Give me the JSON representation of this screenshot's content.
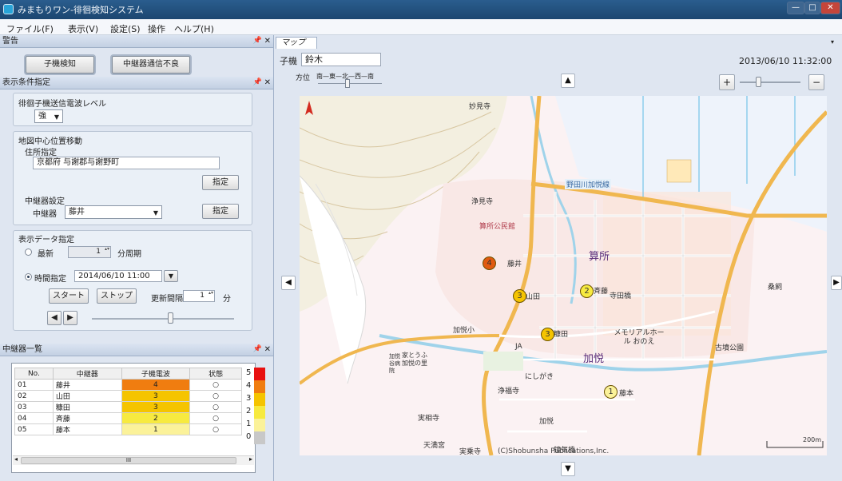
{
  "app": {
    "title": "みまもりワン-徘徊検知システム"
  },
  "window": {
    "min": "—",
    "max": "□",
    "close": "✕"
  },
  "menu": [
    "ファイル(F)",
    "表示(V)",
    "設定(S)",
    "操作",
    "ヘルプ(H)"
  ],
  "alert_panel": {
    "title": "警告",
    "buttons": [
      "子機検知",
      "中継器通信不良"
    ]
  },
  "display_panel": {
    "title": "表示条件指定",
    "signal_level": {
      "label": "徘徊子機送信電波レベル",
      "value": "強"
    },
    "map_center": {
      "label": "地図中心位置移動",
      "address_label": "住所指定",
      "address_value": "京都府 与謝郡与謝野町",
      "address_button": "指定",
      "relay_setting_label": "中継器設定",
      "relay_label": "中継器",
      "relay_value": "藤井",
      "relay_button": "指定"
    },
    "data_spec": {
      "label": "表示データ指定",
      "latest_label": "最新",
      "latest_period": "1",
      "latest_unit": "分周期",
      "time_label": "時間指定",
      "time_value": "2014/06/10 11:00",
      "start_button": "スタート",
      "stop_button": "ストップ",
      "interval_label": "更新間隔",
      "interval_value": "1",
      "interval_unit": "分"
    },
    "playback_slider_value": 0.55
  },
  "relay_panel": {
    "title": "中継器一覧",
    "columns": [
      "No.",
      "中継器",
      "子機電波",
      "状態"
    ],
    "rows": [
      {
        "no": "01",
        "name": "藤井",
        "level": "4",
        "status": "○"
      },
      {
        "no": "02",
        "name": "山田",
        "level": "3",
        "status": "○"
      },
      {
        "no": "03",
        "name": "糠田",
        "level": "3",
        "status": "○"
      },
      {
        "no": "04",
        "name": "斉藤",
        "level": "2",
        "status": "○"
      },
      {
        "no": "05",
        "name": "藤本",
        "level": "1",
        "status": "○"
      }
    ],
    "level_colors": {
      "4": "#f07d10",
      "3": "#f5c400",
      "2": "#f7ea40",
      "1": "#fbf29a",
      "0": "#c8c8c8"
    },
    "legend": [
      "5",
      "4",
      "3",
      "2",
      "1",
      "0"
    ],
    "legend_colors": [
      "#e81010",
      "#f07d10",
      "#f5c400",
      "#f7ea40",
      "#fbf29a",
      "#c8c8c8"
    ],
    "scroll_label": "III"
  },
  "map_panel": {
    "tab": "マップ",
    "child_label": "子機",
    "child_value": "鈴木",
    "direction_label": "方位",
    "direction_scale": "南—東—北—西—南",
    "timestamp": "2013/06/10 11:32:00",
    "zoom_in": "+",
    "zoom_out": "−",
    "zoom_level": 0.3,
    "copyright": "(C)Shobunsha Publications,Inc.",
    "scale_label": "200m",
    "places": {
      "p1": "妙見寺",
      "p2": "浄見寺",
      "p3": "算所公民館",
      "p4": "野田川加悦線",
      "p5": "算所",
      "p6": "加悦",
      "p7": "山田",
      "p8": "藤井",
      "p9": "斉藤",
      "p10": "糠田",
      "p11": "藤本",
      "p12": "寺田橋",
      "p13": "メモリアルホール おのえ",
      "p14": "古墳公園",
      "p15": "JA",
      "p16": "にしがき",
      "p17": "浄福寺",
      "p18": "実相寺",
      "p19": "加悦",
      "p20": "天満宮",
      "p21": "実乗寺",
      "p22": "加悦小",
      "p23": "桑飼",
      "p24": "鐘気橋",
      "p25": "家とうふ 加悦の里",
      "p26": "加悦谷病院"
    },
    "markers": [
      {
        "label": "4",
        "color": "#e05a10"
      },
      {
        "label": "3",
        "color": "#f5c400"
      },
      {
        "label": "3",
        "color": "#f5c400"
      },
      {
        "label": "2",
        "color": "#f7ea40"
      },
      {
        "label": "1",
        "color": "#fbf29a"
      }
    ]
  }
}
